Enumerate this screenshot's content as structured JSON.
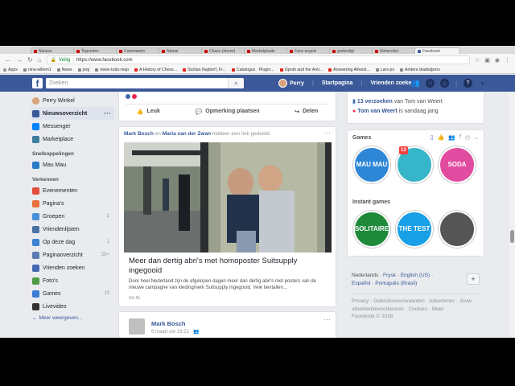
{
  "browser": {
    "tabs": [
      "Nieuws",
      "Tegoeden",
      "Commando",
      "Namai",
      "Chaos (nieuw)",
      "Marketplaats",
      "Fans angels",
      "groterdigi",
      "Sintacolon",
      "Facebook"
    ],
    "secure_label": "Veilig",
    "url": "https://www.facebook.com",
    "bookmarks": [
      "Apps",
      "nina-willem1",
      "News",
      "jorg",
      "news-todo-map",
      "A History of Chess...",
      "Sicilian Najdorf | Fr...",
      "Catalogus · Plugin...",
      "Oprah and the Anti...",
      "Answering Atheist...",
      "Lars-px",
      "Andere bladwijzers"
    ]
  },
  "header": {
    "search_placeholder": "Zoeken",
    "user_name": "Perry",
    "home": "Startpagina",
    "find_friends": "Vrienden zoeken",
    "colors": {
      "brand": "#3b5998",
      "link": "#365899"
    }
  },
  "sidebar": {
    "user": "Perry Winkel",
    "main": [
      {
        "label": "Nieuwsoverzicht",
        "icon": "news-feed-icon",
        "color": "#3b5998"
      },
      {
        "label": "Messenger",
        "icon": "messenger-icon",
        "color": "#0084ff"
      },
      {
        "label": "Marketplace",
        "icon": "marketplace-icon",
        "color": "#3c7e9c"
      }
    ],
    "shortcuts_title": "Snelkoppelingen",
    "shortcuts": [
      {
        "label": "Mau Mau",
        "icon": "mau-mau-icon",
        "color": "#2a7ac9"
      }
    ],
    "explore_title": "Verkennen",
    "explore": [
      {
        "label": "Evenementen",
        "count": "",
        "icon": "calendar-icon",
        "color": "#e24e3b"
      },
      {
        "label": "Pagina's",
        "count": "",
        "icon": "flag-icon",
        "color": "#e8733c"
      },
      {
        "label": "Groepen",
        "count": "2",
        "icon": "groups-icon",
        "color": "#4a90d9"
      },
      {
        "label": "Vriendenlijsten",
        "count": "",
        "icon": "friend-lists-icon",
        "color": "#4a6fa5"
      },
      {
        "label": "Op deze dag",
        "count": "1",
        "icon": "clock-icon",
        "color": "#3b82d1"
      },
      {
        "label": "Paginaoverzicht",
        "count": "20+",
        "icon": "pages-feed-icon",
        "color": "#5b7bb2"
      },
      {
        "label": "Vrienden zoeken",
        "count": "",
        "icon": "find-friends-icon",
        "color": "#4267b2"
      },
      {
        "label": "Foto's",
        "count": "",
        "icon": "photos-icon",
        "color": "#4f9a46"
      },
      {
        "label": "Games",
        "count": "13",
        "icon": "games-icon",
        "color": "#3a7bd5"
      },
      {
        "label": "Livevideo",
        "count": "",
        "icon": "live-video-icon",
        "color": "#333"
      }
    ],
    "more": "Meer weergeven..."
  },
  "feed": {
    "actions": {
      "like": "Leuk",
      "comment": "Opmerking plaatsen",
      "share": "Delen"
    },
    "post1": {
      "author": "Mark Bosch",
      "connector": "en",
      "coauthor": "Maria van der Zwan",
      "rest": "hebben een link gedeeld.",
      "link_title": "Meer dan dertig abri's met homoposter Suitsupply ingegooid",
      "link_desc": "Door heel Nederland zijn de afgelopen dagen meer dan dertig abri's met posters van de nieuwe campagne van kledingmerk Suitsupply ingegooid. Vele tientallen...",
      "source": "NU.NL"
    },
    "post2": {
      "author": "Mark Bosch",
      "date": "6 maart om 18:21 ·"
    }
  },
  "right": {
    "birthdays_count": "13 verzoeken",
    "birthdays_rest": "van Tom van Weert",
    "birthday_name": "Tom van Weert",
    "birthday_rest": "is vandaag jarig",
    "games_title": "Games",
    "games": [
      {
        "label": "MAU MAU",
        "color": "#2e86d6",
        "badge": ""
      },
      {
        "label": "",
        "color": "#38b6c9",
        "badge": "13"
      },
      {
        "label": "SODA",
        "color": "#e14ba0",
        "badge": ""
      }
    ],
    "instant_title": "Instant games",
    "instant": [
      {
        "label": "SOLITAIRE",
        "color": "#1e8a3a"
      },
      {
        "label": "THE TEST",
        "color": "#1aa0e6"
      },
      {
        "label": "",
        "color": "#555"
      }
    ],
    "languages": [
      "Nederlands",
      "Frysk",
      "English (US)",
      "Español",
      "Português (Brasil)"
    ],
    "footer": [
      "Privacy",
      "Gebruiksvoorwaarden",
      "Adverteren",
      "Jouw advertentievoorkeuren",
      "Cookies",
      "Meer",
      "Facebook © 2018"
    ]
  }
}
